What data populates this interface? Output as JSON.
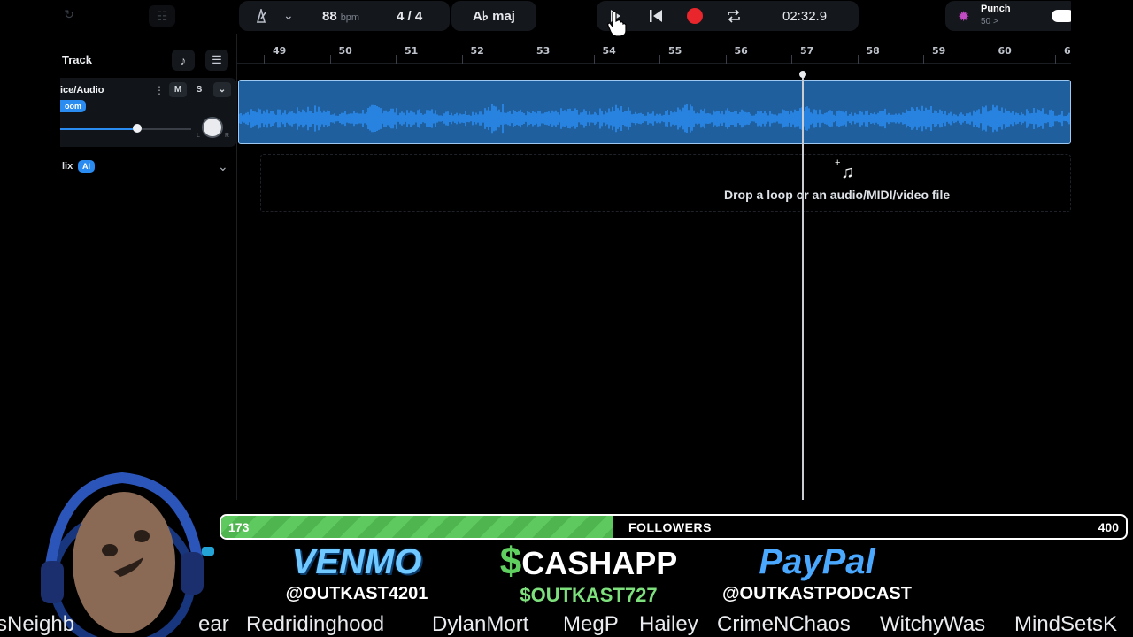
{
  "toolbar": {
    "tempo": "88",
    "tempo_unit": "bpm",
    "time_signature": "4 / 4",
    "key": "A♭ maj",
    "time": "02:32.9",
    "punch_label": "Punch",
    "punch_sub": "50 >",
    "record_color": "#e8262b"
  },
  "ruler": {
    "bars": [
      "49",
      "50",
      "51",
      "52",
      "53",
      "54",
      "55",
      "56",
      "57",
      "58",
      "59",
      "60",
      "6"
    ]
  },
  "panel": {
    "add_track_label": "Track",
    "track": {
      "name": "ice/Audio",
      "badge": "oom",
      "mute": "M",
      "solo": "S",
      "pan_left": "L",
      "pan_right": "R"
    },
    "mix_label": "lix",
    "mix_badge": "AI"
  },
  "dropzone": {
    "text": "Drop a loop or an audio/MIDI/video file"
  },
  "followers": {
    "current": "173",
    "label": "FOLLOWERS",
    "goal": "400",
    "progress": 0.4325
  },
  "payments": {
    "venmo": {
      "brand": "VENMO",
      "handle": "@OUTKAST4201"
    },
    "cashapp": {
      "symbol": "$",
      "brand": "CASHAPP",
      "handle": "$OUTKAST727"
    },
    "paypal": {
      "brand": "PayPal",
      "handle": "@OUTKASTPODCAST"
    }
  },
  "ticker": [
    "sNeighb",
    "ear",
    "Redridinghood",
    "DylanMort",
    "MegP",
    "Hailey",
    "CrimeNChaos",
    "WitchyWas",
    "MindSetsK"
  ],
  "colors": {
    "accent": "#2a8cf0",
    "clip": "#1f5f9e",
    "progress": "#5ec95e",
    "cashapp": "#5fd05f"
  }
}
